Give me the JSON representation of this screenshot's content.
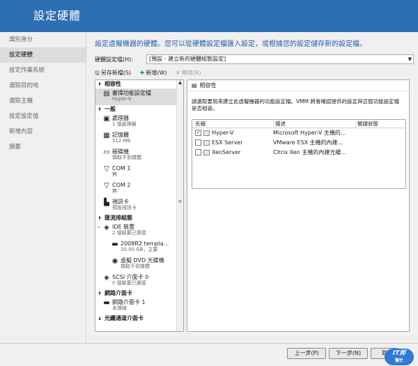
{
  "header": {
    "title": "設定硬體"
  },
  "nav": {
    "items": [
      "識別身分",
      "設定硬體",
      "設定作業系統",
      "選取目的地",
      "選取主機",
      "設定設定值",
      "新增內容",
      "摘要"
    ],
    "active_index": 1
  },
  "main": {
    "description": "設定虛擬機器的硬體。您可以從硬體設定檔匯入設定，或根據您的設定儲存新的設定檔。",
    "profile_label": "硬體設定檔(H):",
    "profile_value": "[預設 - 建立新的硬體組態設定]",
    "toolbar": {
      "save": "另存新檔(S)",
      "new": "新增(W)",
      "remove": "移除(R)"
    }
  },
  "tree": {
    "sections": [
      {
        "name": "相容性",
        "items": [
          {
            "label": "審擇功能設定檔",
            "sub": "Hyper-V",
            "icon": "compat-icon",
            "selected": true
          }
        ]
      },
      {
        "name": "一般",
        "items": [
          {
            "label": "處理器",
            "sub": "1 個處理器",
            "icon": "processor-icon"
          },
          {
            "label": "記憶體",
            "sub": "512 MB",
            "icon": "memory-icon"
          },
          {
            "label": "磁碟機",
            "sub": "擷取不到媒體",
            "icon": "disk-drive-icon"
          },
          {
            "label": "COM 1",
            "sub": "無",
            "icon": "com-port-icon"
          },
          {
            "label": "COM 2",
            "sub": "無",
            "icon": "com-port-icon"
          },
          {
            "label": "視訊卡",
            "sub": "預設視訊卡",
            "icon": "video-card-icon"
          }
        ]
      },
      {
        "name": "匯流排組態",
        "items": [
          {
            "label": "IDE 裝置",
            "sub": "2 個裝置已連接",
            "icon": "ide-icon",
            "expander": "−"
          },
          {
            "label": "2008R2 templa...",
            "sub": "20.00 GB，主要",
            "icon": "vhd-icon",
            "level": 2
          },
          {
            "label": "虛擬 DVD 光碟機",
            "sub": "擷取不到媒體",
            "icon": "dvd-icon",
            "level": 2
          },
          {
            "label": "SCSI 介面卡 0",
            "sub": "0 個裝置已連接",
            "icon": "scsi-icon"
          }
        ]
      },
      {
        "name": "網路介面卡",
        "items": [
          {
            "label": "網路介面卡 1",
            "sub": "未連線",
            "icon": "network-adapter-icon"
          }
        ]
      },
      {
        "name": "光纖通道介面卡",
        "items": []
      }
    ]
  },
  "detail": {
    "header": "相容性",
    "text": "請選取要用來建立此虛擬機器的功能設定檔。VMM 將會確認提供的設定與這個功能設定檔是否相容。",
    "columns": [
      "名稱",
      "描述",
      "驗證狀態"
    ],
    "rows": [
      {
        "name": "Hyper-V",
        "desc": "Microsoft Hyper-V 主機的...",
        "status": "",
        "checked": true
      },
      {
        "name": "ESX Server",
        "desc": "VMware ESX 主機的內建...",
        "status": "",
        "checked": false
      },
      {
        "name": "XenServer",
        "desc": "Citrix Xen 主機的內建光緩...",
        "status": "",
        "checked": false
      }
    ]
  },
  "footer": {
    "prev": "上一步(P)",
    "next": "下一步(N)",
    "cancel": "取"
  },
  "logo": {
    "text": "IT邦",
    "sub": "幫忙"
  }
}
